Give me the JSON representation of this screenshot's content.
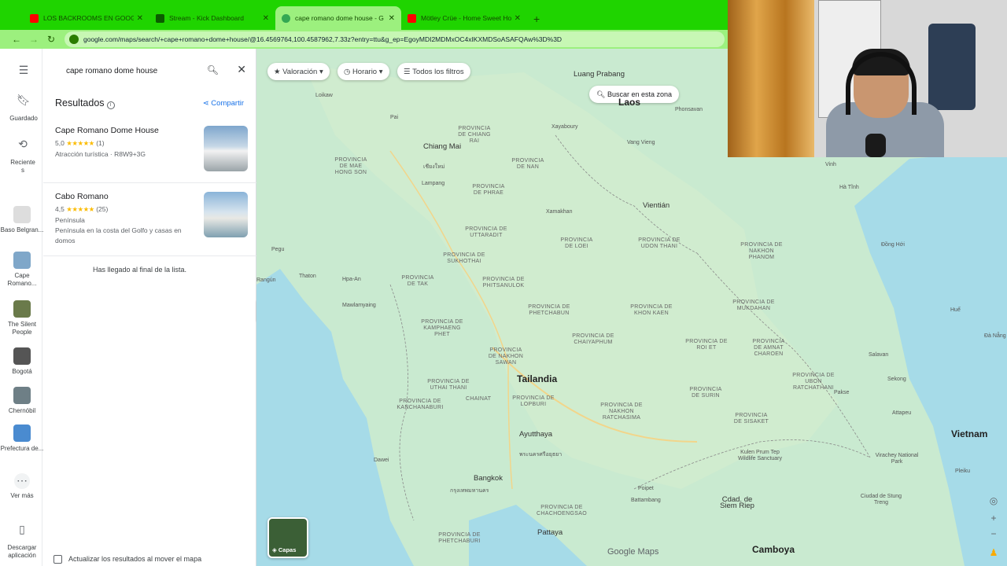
{
  "browser": {
    "tabs": [
      {
        "title": "LOS BACKROOMS EN GOOGLE",
        "icon": "youtube-icon",
        "color": "#ff0000",
        "active": false
      },
      {
        "title": "Stream - Kick Dashboard",
        "icon": "kick-icon",
        "color": "#53fc18",
        "active": false
      },
      {
        "title": "cape romano dome house - G",
        "icon": "google-maps-icon",
        "color": "#34a853",
        "active": true
      },
      {
        "title": "Mötley Crüe - Home Sweet Ho",
        "icon": "youtube-icon",
        "color": "#ff0000",
        "active": false
      }
    ],
    "url": "google.com/maps/search/+cape+romano+dome+house/@16.4569764,100.4587962,7.33z?entry=ttu&g_ep=EgoyMDI2MDMxOC4xIKXMDSoASAFQAw%3D%3D"
  },
  "rail": {
    "saved": "Guardado",
    "recent": "Recientes",
    "recent_items": [
      "Baso Belgran...",
      "Cape Romano...",
      "The Silent People",
      "Bogotá",
      "Chernóbil",
      "Prefectura de..."
    ],
    "more": "Ver más",
    "download": "Descargar aplicación"
  },
  "panel": {
    "query": "cape romano dome house",
    "results_title": "Resultados",
    "share_label": "Compartir",
    "results": [
      {
        "name": "Cape Romano Dome House",
        "rating": "5,0",
        "stars": "★★★★★",
        "count": "(1)",
        "line1": "Atracción turística · R8W9+3G",
        "line2": ""
      },
      {
        "name": "Cabo Romano",
        "rating": "4,5",
        "stars": "★★★★★",
        "count": "(25)",
        "line1": "Península",
        "line2": "Península en la costa del Golfo y casas en domos"
      }
    ],
    "end_of_list": "Has llegado al final de la lista.",
    "update_on_move": "Actualizar los resultados al mover el mapa"
  },
  "map": {
    "filters": [
      "Valoración",
      "Horario",
      "Todos los filtros"
    ],
    "search_area": "Buscar en esta zona",
    "layers_label": "Capas",
    "attribution": "Google Maps",
    "countries": {
      "laos": "Laos",
      "tailandia": "Tailandia",
      "vietnam": "Vietnam",
      "camboya": "Camboya"
    },
    "cities": {
      "chiang_mai": "Chiang Mai",
      "chiang_mai_th": "เชียงใหม่",
      "luang_prabang": "Luang Prabang",
      "vientian": "Vientián",
      "ayutthaya": "Ayutthaya",
      "ayutthaya_th": "พระนครศรีอยุธยา",
      "bangkok": "Bangkok",
      "bangkok_th": "กรุงเทพมหานคร",
      "pattaya": "Pattaya",
      "siem_riep": "Cdad. de Siem Riep",
      "mawlamyaing": "Mawlamyaing",
      "pakse": "Pakse",
      "dong_hoi": "Đồng Hới",
      "hue": "Huế",
      "vinh": "Vinh",
      "da_nang": "Đà Nẵng",
      "pleiku": "Pleiku",
      "thaton": "Thaton",
      "pegu": "Pegu",
      "rangun": "Rangún",
      "lampang": "Lampang",
      "vang_vieng": "Vang Vieng",
      "xamakhan": "Xamakhan",
      "salavan": "Salavan",
      "sekong": "Sekong",
      "attapeu": "Attapeu",
      "xayaboury": "Xayaboury",
      "phonsavan": "Phonsavan",
      "dawei": "Dawei",
      "battambang": "Battambang",
      "poipet": "Poipet",
      "ha_tinh": "Hà Tĩnh",
      "pai": "Pai",
      "loikaw": "Loikaw",
      "pha_an": "Hpa-An",
      "kulen": "Kulen Prum Tep Wildlife Sanctuary",
      "virachey": "Virachey National Park",
      "ciudad_stung": "Ciudad de Stung Treng"
    },
    "provinces": {
      "chiang_rai": "PROVINCIA DE CHIANG RAI",
      "mae_hong_son": "PROVINCIA DE MAE HONG SON",
      "nan": "PROVINCIA DE NAN",
      "phrae": "PROVINCIA DE PHRAE",
      "uttaradit": "PROVINCIA DE UTTARADIT",
      "sukhothai": "PROVINCIA DE SUKHOTHAI",
      "tak": "PROVINCIA DE TAK",
      "phitsanulok": "PROVINCIA DE PHITSANULOK",
      "loei": "PROVINCIA DE LOEI",
      "udon_thani": "PROVINCIA DE UDON THANI",
      "nakhon_phanom": "PROVINCIA DE NAKHON PHANOM",
      "kamphaeng": "PROVINCIA DE KAMPHAENG PHET",
      "phetchabun": "PROVINCIA DE PHETCHABUN",
      "khon_kaen": "PROVINCIA DE KHON KAEN",
      "mukdahan": "PROVINCIA DE MUKDAHAN",
      "chaiyaphum": "PROVINCIA DE CHAIYAPHUM",
      "roi_et": "PROVINCIA DE ROI ET",
      "amnat": "PROVINCIA DE AMNAT CHAROEN",
      "nakhon_sawan": "PROVINCIA DE NAKHON SAWAN",
      "uthai_thani": "PROVINCIA DE UTHAI THANI",
      "lopburi": "PROVINCIA DE LOPBURI",
      "chainat": "CHAINAT",
      "nakhon_ratchasima": "PROVINCIA DE NAKHON RATCHASIMA",
      "surin": "PROVINCIA DE SURIN",
      "ubon": "PROVINCIA DE UBON RATCHATHANI",
      "sisaket": "PROVINCIA DE SISAKET",
      "kanchanaburi": "PROVINCIA DE KANCHANABURI",
      "chachoengsao": "PROVINCIA DE CHACHOENGSAO",
      "phetchaburi": "PROVINCIA DE PHETCHABURI"
    }
  }
}
